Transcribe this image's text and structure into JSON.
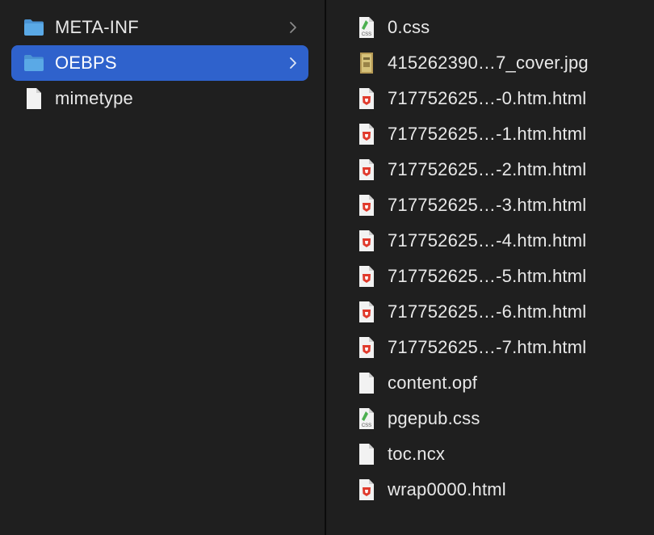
{
  "left_column": {
    "items": [
      {
        "label": "META-INF",
        "icon": "folder-icon",
        "selected": false,
        "has_children": true
      },
      {
        "label": "OEBPS",
        "icon": "folder-icon",
        "selected": true,
        "has_children": true
      },
      {
        "label": "mimetype",
        "icon": "document-icon",
        "selected": false,
        "has_children": false
      }
    ]
  },
  "right_column": {
    "items": [
      {
        "label": "0.css",
        "icon": "css-file-icon"
      },
      {
        "label": "415262390…7_cover.jpg",
        "icon": "image-file-icon"
      },
      {
        "label": "717752625…-0.htm.html",
        "icon": "html-file-icon"
      },
      {
        "label": "717752625…-1.htm.html",
        "icon": "html-file-icon"
      },
      {
        "label": "717752625…-2.htm.html",
        "icon": "html-file-icon"
      },
      {
        "label": "717752625…-3.htm.html",
        "icon": "html-file-icon"
      },
      {
        "label": "717752625…-4.htm.html",
        "icon": "html-file-icon"
      },
      {
        "label": "717752625…-5.htm.html",
        "icon": "html-file-icon"
      },
      {
        "label": "717752625…-6.htm.html",
        "icon": "html-file-icon"
      },
      {
        "label": "717752625…-7.htm.html",
        "icon": "html-file-icon"
      },
      {
        "label": "content.opf",
        "icon": "document-icon"
      },
      {
        "label": "pgepub.css",
        "icon": "css-file-icon"
      },
      {
        "label": "toc.ncx",
        "icon": "document-icon"
      },
      {
        "label": "wrap0000.html",
        "icon": "html-file-icon"
      }
    ]
  },
  "colors": {
    "background": "#1f1f1f",
    "selection": "#2f62cc",
    "folder": "#5aa9e6",
    "html_badge": "#e0392b"
  }
}
